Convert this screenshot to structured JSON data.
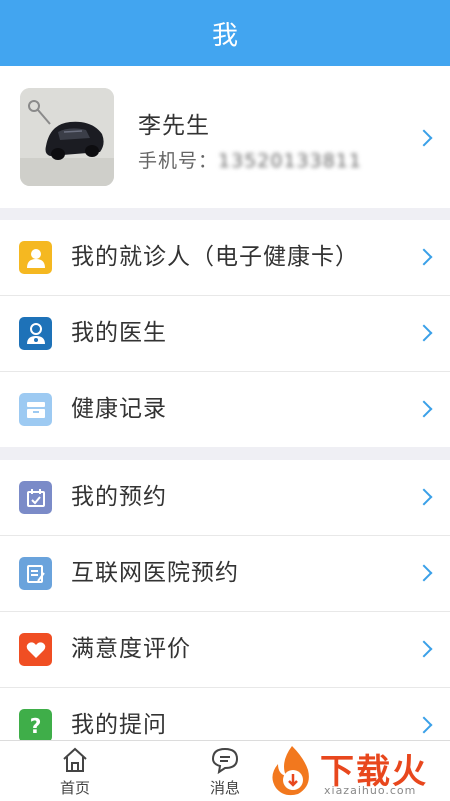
{
  "header": {
    "title": "我"
  },
  "profile": {
    "name": "李先生",
    "phone_label": "手机号：",
    "phone": "13520133811"
  },
  "menu_group1": [
    {
      "label": "我的就诊人（电子健康卡）",
      "icon": "person-icon",
      "color": "#f5b821"
    },
    {
      "label": "我的医生",
      "icon": "doctor-icon",
      "color": "#1e72b8"
    },
    {
      "label": "健康记录",
      "icon": "records-icon",
      "color": "#9dcaf2"
    }
  ],
  "menu_group2": [
    {
      "label": "我的预约",
      "icon": "calendar-icon",
      "color": "#7b8bc8"
    },
    {
      "label": "互联网医院预约",
      "icon": "edit-note-icon",
      "color": "#6aa3dc"
    },
    {
      "label": "满意度评价",
      "icon": "heart-icon",
      "color": "#f04e23"
    },
    {
      "label": "我的提问",
      "icon": "question-icon",
      "color": "#3fae49"
    }
  ],
  "tabbar": {
    "home": "首页",
    "messages": "消息"
  },
  "watermark": {
    "text": "下载火",
    "sub": "xiazaihuo.com"
  },
  "colors": {
    "header_bg": "#42a5f0",
    "chevron": "#3aa0e8",
    "page_bg": "#efeff4"
  }
}
